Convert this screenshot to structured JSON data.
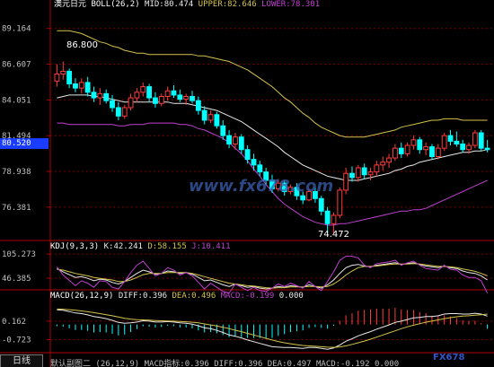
{
  "colors": {
    "up": "#ff3c3c",
    "down": "#00ffff",
    "boll_mid": "#e8e8e8",
    "boll_upper": "#d4c24a",
    "boll_lower": "#c040d0",
    "kdj_k": "#e8e8e8",
    "kdj_d": "#d4c24a",
    "kdj_j": "#c040d0",
    "grid": "#7a0000",
    "axis": "#b00000"
  },
  "header": {
    "title": "澳元日元",
    "indicator": "BOLL(26,2)",
    "mid": "MID:80.474",
    "upper": "UPPER:82.646",
    "lower": "LOWER:78.301"
  },
  "kdj_header": {
    "label": "KDJ(9,3,3)",
    "k": "K:42.241",
    "d": "D:58.155",
    "j": "J:10.411"
  },
  "macd_header": {
    "label": "MACD(26,12,9)",
    "diff": "DIFF:0.396",
    "dea": "DEA:0.496",
    "macd": "MACD:-0.199",
    "extra": "0.000"
  },
  "current_price": "80.520",
  "annotations": {
    "high": "86.800",
    "low": "74.472"
  },
  "watermark": "www.fx678.com",
  "watermark_corner": "FX678",
  "bottom": {
    "tab": "日线",
    "text": "默认副图二 (26,12,9) MACD指标:0.396 DIFF:0.396 DEA:0.497 MACD:-0.192 0.000"
  },
  "chart_data": [
    {
      "type": "candlestick",
      "title": "澳元日元 BOLL(26,2)",
      "ylim": [
        74.0,
        90.3
      ],
      "yticks": [
        "89.164",
        "86.607",
        "84.051",
        "81.494",
        "78.938",
        "76.381"
      ],
      "ytick_values": [
        89.164,
        86.607,
        84.051,
        81.494,
        78.938,
        76.381
      ],
      "candles": [
        [
          85.4,
          86.6,
          85.0,
          85.9
        ],
        [
          85.9,
          86.8,
          85.5,
          86.1
        ],
        [
          86.1,
          86.3,
          84.9,
          85.2
        ],
        [
          85.2,
          85.6,
          84.6,
          84.9
        ],
        [
          84.9,
          85.6,
          84.5,
          85.3
        ],
        [
          85.3,
          85.7,
          84.3,
          84.6
        ],
        [
          84.6,
          85.0,
          83.9,
          84.2
        ],
        [
          84.2,
          84.9,
          83.7,
          84.5
        ],
        [
          84.5,
          84.8,
          83.8,
          84.0
        ],
        [
          84.0,
          84.4,
          83.2,
          83.5
        ],
        [
          83.5,
          83.9,
          82.6,
          82.9
        ],
        [
          82.9,
          83.7,
          82.7,
          83.5
        ],
        [
          83.5,
          84.5,
          83.3,
          84.2
        ],
        [
          84.2,
          84.9,
          83.9,
          84.6
        ],
        [
          84.6,
          85.3,
          84.3,
          85.0
        ],
        [
          85.0,
          85.2,
          83.9,
          84.2
        ],
        [
          84.2,
          84.6,
          83.5,
          83.8
        ],
        [
          83.8,
          84.5,
          83.6,
          84.3
        ],
        [
          84.3,
          85.0,
          84.0,
          84.7
        ],
        [
          84.7,
          85.1,
          84.2,
          84.4
        ],
        [
          84.4,
          84.8,
          83.9,
          84.1
        ],
        [
          84.1,
          84.5,
          83.7,
          84.3
        ],
        [
          84.3,
          84.7,
          83.8,
          84.0
        ],
        [
          84.0,
          84.3,
          83.0,
          83.3
        ],
        [
          83.3,
          83.6,
          82.3,
          82.6
        ],
        [
          82.6,
          83.3,
          82.4,
          83.0
        ],
        [
          83.0,
          83.2,
          82.0,
          82.2
        ],
        [
          82.2,
          82.6,
          81.2,
          81.5
        ],
        [
          81.5,
          81.9,
          80.6,
          80.9
        ],
        [
          80.9,
          81.7,
          80.5,
          81.4
        ],
        [
          81.4,
          81.6,
          80.2,
          80.5
        ],
        [
          80.5,
          80.8,
          79.5,
          79.8
        ],
        [
          79.8,
          80.2,
          79.0,
          79.4
        ],
        [
          79.4,
          79.7,
          78.6,
          78.9
        ],
        [
          78.9,
          79.2,
          78.0,
          78.3
        ],
        [
          78.3,
          78.7,
          77.4,
          77.7
        ],
        [
          77.7,
          78.4,
          77.5,
          78.1
        ],
        [
          78.1,
          78.3,
          77.2,
          77.5
        ],
        [
          77.5,
          78.0,
          77.3,
          77.8
        ],
        [
          77.8,
          78.1,
          76.9,
          77.2
        ],
        [
          77.2,
          77.5,
          76.6,
          76.9
        ],
        [
          76.9,
          77.7,
          76.8,
          77.5
        ],
        [
          77.5,
          77.8,
          76.7,
          77.0
        ],
        [
          77.0,
          77.2,
          75.8,
          76.1
        ],
        [
          76.1,
          76.4,
          74.5,
          75.2
        ],
        [
          75.2,
          76.0,
          74.5,
          75.8
        ],
        [
          75.8,
          77.8,
          75.6,
          77.6
        ],
        [
          77.6,
          79.2,
          77.3,
          78.8
        ],
        [
          78.8,
          79.3,
          78.2,
          78.5
        ],
        [
          78.5,
          79.4,
          78.2,
          79.2
        ],
        [
          79.2,
          79.5,
          78.4,
          78.7
        ],
        [
          78.7,
          79.2,
          78.3,
          78.9
        ],
        [
          78.9,
          79.7,
          78.6,
          79.4
        ],
        [
          79.4,
          80.0,
          79.0,
          79.6
        ],
        [
          79.6,
          80.2,
          79.2,
          79.9
        ],
        [
          79.9,
          80.9,
          79.7,
          80.6
        ],
        [
          80.6,
          81.0,
          79.9,
          80.2
        ],
        [
          80.2,
          81.0,
          80.0,
          80.8
        ],
        [
          80.8,
          81.5,
          80.5,
          81.2
        ],
        [
          81.2,
          81.4,
          80.2,
          80.5
        ],
        [
          80.5,
          81.0,
          80.1,
          80.7
        ],
        [
          80.7,
          80.9,
          79.8,
          80.0
        ],
        [
          80.0,
          80.9,
          79.8,
          80.6
        ],
        [
          80.6,
          81.7,
          80.4,
          81.5
        ],
        [
          81.5,
          81.9,
          80.8,
          81.1
        ],
        [
          81.1,
          81.8,
          80.7,
          80.9
        ],
        [
          80.9,
          81.2,
          80.3,
          80.5
        ],
        [
          80.5,
          81.0,
          80.2,
          80.8
        ],
        [
          80.8,
          81.9,
          80.6,
          81.7
        ],
        [
          81.7,
          81.9,
          80.4,
          80.6
        ],
        [
          80.6,
          81.2,
          80.3,
          80.5
        ]
      ],
      "boll_mid": [
        84.2,
        84.3,
        84.4,
        84.4,
        84.4,
        84.4,
        84.3,
        84.3,
        84.2,
        84.1,
        84.0,
        83.9,
        83.9,
        83.9,
        83.9,
        83.9,
        83.9,
        83.9,
        83.9,
        83.8,
        83.8,
        83.8,
        83.7,
        83.6,
        83.5,
        83.4,
        83.3,
        83.1,
        82.9,
        82.7,
        82.5,
        82.2,
        81.9,
        81.6,
        81.3,
        81.0,
        80.7,
        80.3,
        80.0,
        79.7,
        79.4,
        79.2,
        79.0,
        78.8,
        78.6,
        78.5,
        78.4,
        78.3,
        78.3,
        78.3,
        78.4,
        78.5,
        78.6,
        78.7,
        78.8,
        79.0,
        79.1,
        79.3,
        79.4,
        79.6,
        79.7,
        79.8,
        79.9,
        80.0,
        80.1,
        80.2,
        80.3,
        80.3,
        80.4,
        80.4,
        80.5
      ],
      "boll_upper": [
        89.0,
        89.0,
        89.0,
        88.9,
        88.8,
        88.6,
        88.4,
        88.2,
        88.1,
        87.9,
        87.8,
        87.6,
        87.5,
        87.4,
        87.4,
        87.3,
        87.3,
        87.3,
        87.3,
        87.3,
        87.3,
        87.3,
        87.3,
        87.2,
        87.2,
        87.1,
        87.0,
        86.9,
        86.8,
        86.6,
        86.4,
        86.2,
        85.9,
        85.6,
        85.3,
        85.0,
        84.6,
        84.2,
        83.9,
        83.5,
        83.1,
        82.8,
        82.4,
        82.1,
        81.9,
        81.7,
        81.5,
        81.4,
        81.4,
        81.4,
        81.4,
        81.5,
        81.6,
        81.7,
        81.8,
        81.9,
        82.1,
        82.2,
        82.3,
        82.4,
        82.5,
        82.6,
        82.6,
        82.7,
        82.7,
        82.7,
        82.6,
        82.6,
        82.6,
        82.6,
        82.6
      ],
      "boll_lower": [
        82.4,
        82.4,
        82.3,
        82.3,
        82.3,
        82.3,
        82.3,
        82.3,
        82.3,
        82.3,
        82.2,
        82.2,
        82.3,
        82.3,
        82.3,
        82.4,
        82.4,
        82.4,
        82.4,
        82.4,
        82.3,
        82.3,
        82.2,
        82.0,
        81.9,
        81.7,
        81.5,
        81.3,
        81.0,
        80.6,
        80.2,
        79.7,
        79.1,
        78.6,
        78.0,
        77.5,
        77.0,
        76.6,
        76.3,
        76.0,
        75.7,
        75.5,
        75.3,
        75.2,
        75.1,
        75.1,
        75.2,
        75.2,
        75.3,
        75.4,
        75.5,
        75.6,
        75.7,
        75.8,
        75.9,
        76.0,
        76.1,
        76.1,
        76.2,
        76.2,
        76.3,
        76.5,
        76.7,
        76.9,
        77.1,
        77.3,
        77.5,
        77.7,
        77.9,
        78.1,
        78.3
      ]
    },
    {
      "type": "line",
      "title": "KDJ(9,3,3)",
      "ylim": [
        20,
        110
      ],
      "yticks": [
        "105.273",
        "46.385"
      ],
      "ytick_values": [
        105.273,
        46.385
      ],
      "series": [
        {
          "name": "K",
          "values": [
            70,
            62,
            55,
            48,
            50,
            46,
            40,
            44,
            42,
            36,
            32,
            38,
            48,
            58,
            66,
            62,
            56,
            58,
            64,
            62,
            58,
            60,
            56,
            48,
            40,
            42,
            36,
            30,
            26,
            32,
            28,
            24,
            26,
            22,
            20,
            22,
            26,
            24,
            28,
            26,
            24,
            30,
            26,
            22,
            30,
            42,
            58,
            72,
            78,
            80,
            76,
            74,
            78,
            80,
            82,
            84,
            80,
            82,
            84,
            80,
            76,
            74,
            72,
            76,
            72,
            70,
            64,
            60,
            58,
            52,
            42
          ]
        },
        {
          "name": "D",
          "values": [
            68,
            66,
            62,
            58,
            55,
            52,
            48,
            46,
            44,
            42,
            38,
            38,
            42,
            48,
            55,
            58,
            58,
            58,
            60,
            60,
            60,
            60,
            58,
            54,
            50,
            46,
            42,
            38,
            34,
            32,
            30,
            28,
            27,
            25,
            23,
            22,
            23,
            23,
            25,
            25,
            25,
            26,
            26,
            25,
            26,
            32,
            42,
            54,
            64,
            72,
            75,
            75,
            76,
            78,
            80,
            81,
            81,
            81,
            82,
            81,
            79,
            77,
            75,
            75,
            74,
            72,
            69,
            66,
            63,
            58,
            52
          ]
        },
        {
          "name": "J",
          "values": [
            74,
            54,
            41,
            28,
            40,
            34,
            24,
            40,
            38,
            24,
            20,
            38,
            60,
            78,
            88,
            70,
            52,
            58,
            72,
            66,
            54,
            60,
            52,
            36,
            20,
            34,
            24,
            14,
            10,
            32,
            24,
            16,
            24,
            16,
            14,
            22,
            32,
            26,
            34,
            28,
            22,
            38,
            26,
            16,
            38,
            62,
            90,
            100,
            100,
            96,
            78,
            72,
            82,
            84,
            86,
            90,
            78,
            84,
            88,
            78,
            70,
            68,
            66,
            78,
            68,
            66,
            54,
            48,
            48,
            40,
            10
          ]
        }
      ]
    },
    {
      "type": "bar",
      "title": "MACD(26,12,9)",
      "ylim": [
        -1.3,
        1.1
      ],
      "yticks": [
        "0.162",
        "-0.723"
      ],
      "ytick_values": [
        0.162,
        -0.723
      ],
      "series": [
        {
          "name": "DIFF",
          "values": [
            0.7,
            0.68,
            0.62,
            0.55,
            0.52,
            0.46,
            0.38,
            0.34,
            0.28,
            0.2,
            0.1,
            0.06,
            0.08,
            0.12,
            0.18,
            0.16,
            0.12,
            0.12,
            0.14,
            0.12,
            0.08,
            0.06,
            0.02,
            -0.06,
            -0.16,
            -0.2,
            -0.28,
            -0.38,
            -0.5,
            -0.56,
            -0.64,
            -0.74,
            -0.82,
            -0.9,
            -0.98,
            -1.06,
            -1.08,
            -1.1,
            -1.1,
            -1.12,
            -1.14,
            -1.1,
            -1.1,
            -1.14,
            -1.18,
            -1.12,
            -0.98,
            -0.8,
            -0.68,
            -0.54,
            -0.44,
            -0.34,
            -0.22,
            -0.12,
            -0.02,
            0.1,
            0.16,
            0.24,
            0.32,
            0.34,
            0.38,
            0.38,
            0.42,
            0.5,
            0.52,
            0.52,
            0.5,
            0.5,
            0.54,
            0.5,
            0.4
          ]
        },
        {
          "name": "DEA",
          "values": [
            0.74,
            0.73,
            0.71,
            0.68,
            0.65,
            0.61,
            0.57,
            0.52,
            0.47,
            0.42,
            0.36,
            0.3,
            0.26,
            0.23,
            0.22,
            0.21,
            0.19,
            0.18,
            0.17,
            0.16,
            0.15,
            0.13,
            0.11,
            0.08,
            0.03,
            -0.02,
            -0.07,
            -0.13,
            -0.2,
            -0.27,
            -0.34,
            -0.42,
            -0.5,
            -0.58,
            -0.66,
            -0.74,
            -0.81,
            -0.87,
            -0.92,
            -0.96,
            -1.0,
            -1.02,
            -1.04,
            -1.06,
            -1.08,
            -1.09,
            -1.07,
            -1.02,
            -0.95,
            -0.87,
            -0.79,
            -0.7,
            -0.6,
            -0.5,
            -0.4,
            -0.3,
            -0.2,
            -0.11,
            -0.03,
            0.04,
            0.11,
            0.17,
            0.22,
            0.28,
            0.33,
            0.37,
            0.4,
            0.42,
            0.45,
            0.47,
            0.5
          ]
        }
      ]
    }
  ]
}
